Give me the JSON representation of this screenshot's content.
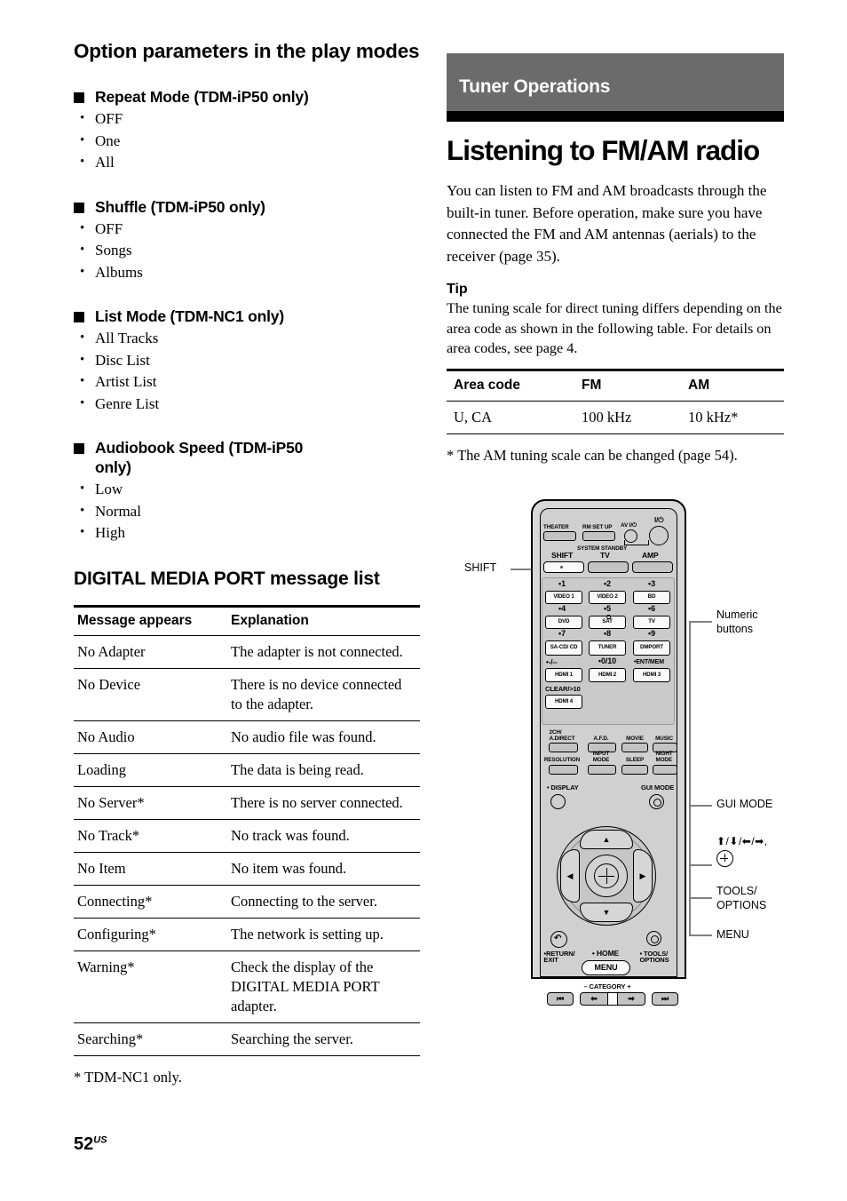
{
  "left_column": {
    "section_title": "Option parameters in the play modes",
    "groups": [
      {
        "heading": "Repeat Mode (TDM-iP50 only)",
        "items": [
          "OFF",
          "One",
          "All"
        ]
      },
      {
        "heading": "Shuffle (TDM-iP50 only)",
        "items": [
          "OFF",
          "Songs",
          "Albums"
        ]
      },
      {
        "heading": "List Mode (TDM-NC1 only)",
        "items": [
          "All Tracks",
          "Disc List",
          "Artist List",
          "Genre List"
        ]
      },
      {
        "heading": "Audiobook Speed (TDM-iP50",
        "heading_cont": "only)",
        "items": [
          "Low",
          "Normal",
          "High"
        ]
      }
    ],
    "message_list": {
      "title": "DIGITAL MEDIA PORT message list",
      "headers": [
        "Message appears",
        "Explanation"
      ],
      "rows": [
        [
          "No Adapter",
          "The adapter is not connected."
        ],
        [
          "No Device",
          "There is no device connected to the adapter."
        ],
        [
          "No Audio",
          "No audio file was found."
        ],
        [
          "Loading",
          "The data is being read."
        ],
        [
          "No Server*",
          "There is no server connected."
        ],
        [
          "No Track*",
          "No track was found."
        ],
        [
          "No Item",
          "No item was found."
        ],
        [
          "Connecting*",
          "Connecting to the server."
        ],
        [
          "Configuring*",
          "The network is setting up."
        ],
        [
          "Warning*",
          "Check the display of the DIGITAL MEDIA PORT adapter."
        ],
        [
          "Searching*",
          "Searching the server."
        ]
      ],
      "footnote": "* TDM-NC1 only."
    }
  },
  "right_column": {
    "banner": "Tuner Operations",
    "banner_bg": "#6b6b6b",
    "title": "Listening to FM/AM radio",
    "intro": "You can listen to FM and AM broadcasts through the built-in tuner. Before operation, make sure you have connected the FM and AM antennas (aerials) to the receiver (page 35).",
    "tip_heading": "Tip",
    "tip_body": "The tuning scale for direct tuning differs depending on the area code as shown in the following table. For details on area codes, see page 4.",
    "area_table": {
      "headers": [
        "Area code",
        "FM",
        "AM"
      ],
      "rows": [
        [
          "U, CA",
          "100 kHz",
          "10 kHz*"
        ]
      ]
    },
    "area_footnote": "* The AM tuning scale can be changed (page 54)."
  },
  "remote": {
    "top_row": {
      "theater": "THEATER",
      "rm_set_up": "RM SET UP",
      "av_power": "AV I/⏻",
      "main_power": "I/⏻",
      "system_standby": "SYSTEM STANDBY"
    },
    "mode_row": {
      "shift": "SHIFT",
      "tv": "TV",
      "amp": "AMP"
    },
    "numeric": [
      {
        "num": "1",
        "label": "VIDEO 1"
      },
      {
        "num": "2",
        "label": "VIDEO 2"
      },
      {
        "num": "3",
        "label": "BD"
      },
      {
        "num": "4",
        "label": "DVD"
      },
      {
        "num": "5",
        "label": "SAT"
      },
      {
        "num": "6",
        "label": "TV"
      },
      {
        "num": "7",
        "label": "SA-CD/ CD"
      },
      {
        "num": "8",
        "label": "TUNER"
      },
      {
        "num": "9",
        "label": "DMPORT"
      },
      {
        "num": "-/--",
        "label": "HDMI 1"
      },
      {
        "num": "0/10",
        "label": "HDMI 2"
      },
      {
        "num": "ENT/MEM",
        "label": "HDMI 3"
      },
      {
        "num": "CLEAR/>10",
        "label": "HDMI 4"
      }
    ],
    "sound_fields": {
      "two_ch": "2CH/ A.DIRECT",
      "afd": "A.F.D.",
      "movie": "MOVIE",
      "music": "MUSIC",
      "resolution": "RESOLUTION",
      "input_mode": "INPUT MODE",
      "sleep": "SLEEP",
      "night_mode": "NIGHT MODE"
    },
    "lower": {
      "display": "DISPLAY",
      "gui_mode": "GUI MODE",
      "return_exit": "RETURN/ EXIT",
      "home": "HOME",
      "menu": "MENU",
      "tools_options": "TOOLS/ OPTIONS",
      "category": "CATEGORY"
    },
    "callouts": {
      "shift": "SHIFT",
      "numeric_buttons": "Numeric buttons",
      "gui_mode": "GUI MODE",
      "arrows": "⬆/⬇/⬅/➡,",
      "tools_options": "TOOLS/ OPTIONS",
      "menu": "MENU"
    }
  },
  "page_number": {
    "value": "52",
    "suffix": "US"
  }
}
